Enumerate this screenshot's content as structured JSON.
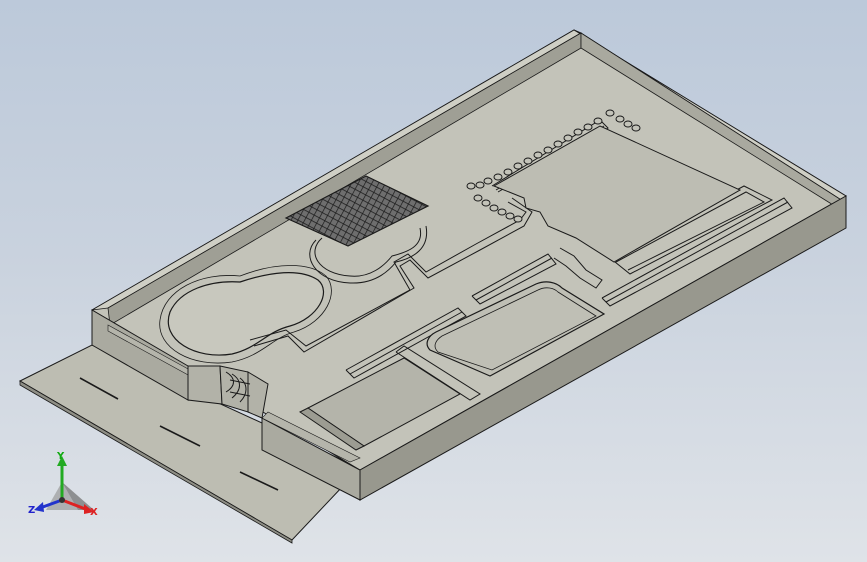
{
  "viewport": {
    "background_top": "#bcc9da",
    "background_bottom": "#dfe3e8"
  },
  "model": {
    "face_color": "#c2c2b8",
    "wall_color": "#a4a49a",
    "edge_color": "#1a1a1a"
  },
  "triad": {
    "x_label": "X",
    "y_label": "Y",
    "z_label": "Z",
    "x_color": "#dd2222",
    "y_color": "#22aa22",
    "z_color": "#2233cc",
    "icon": "coordinate-triad-icon"
  }
}
